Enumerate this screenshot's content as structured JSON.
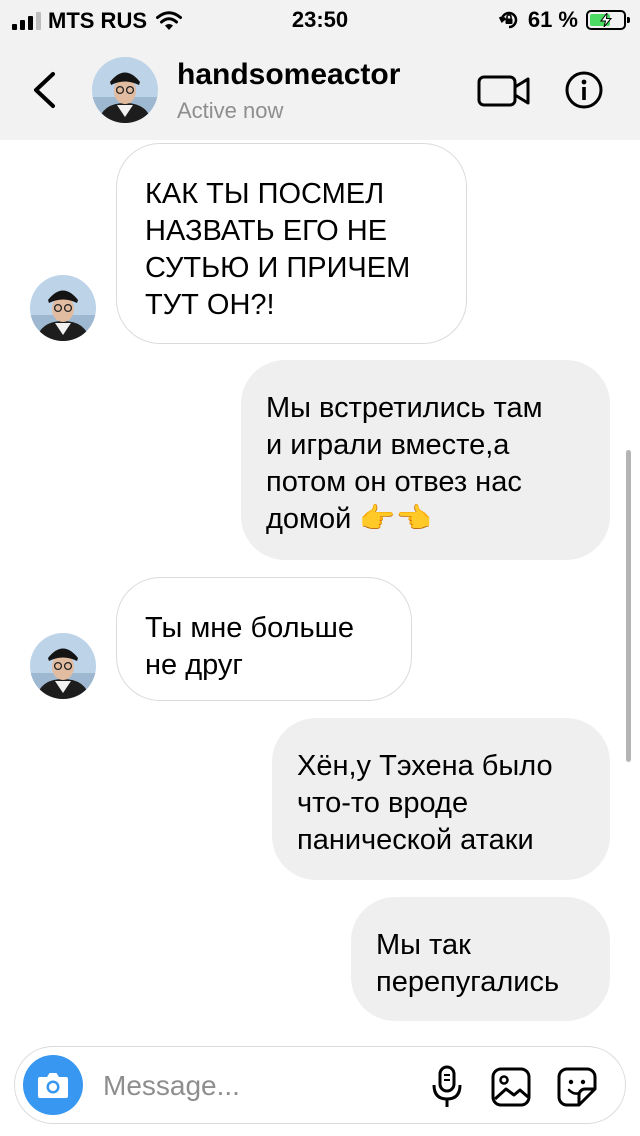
{
  "status_bar": {
    "carrier": "MTS RUS",
    "time": "23:50",
    "battery": "61 %",
    "battery_level": 0.61,
    "icons": [
      "signal-bars-icon",
      "wifi-icon",
      "orientation-lock-icon",
      "battery-charging-icon"
    ]
  },
  "header": {
    "username": "handsomeactor",
    "status": "Active now",
    "icons": [
      "back-chevron-icon",
      "video-call-icon",
      "info-icon"
    ]
  },
  "messages": [
    {
      "direction": "in",
      "lines": [
        "КАК ТЫ ПОСМЕЛ",
        "НАЗВАТЬ ЕГО НЕ",
        "СУТЬЮ И ПРИЧЕМ",
        "ТУТ ОН?!"
      ]
    },
    {
      "direction": "out",
      "lines": [
        "Мы встретились там",
        "и играли вместе,а",
        "потом он отвез нас",
        "домой 👉👈"
      ]
    },
    {
      "direction": "in",
      "lines": [
        "Ты мне больше",
        "не друг"
      ]
    },
    {
      "direction": "out",
      "lines": [
        "Хён,у Тэхена было",
        "что-то вроде",
        "панической атаки"
      ]
    },
    {
      "direction": "out",
      "lines": [
        "Мы так",
        "перепугались"
      ]
    }
  ],
  "composer": {
    "placeholder": "Message...",
    "value": "",
    "icons": [
      "camera-icon",
      "microphone-icon",
      "gallery-icon",
      "sticker-icon"
    ]
  },
  "colors": {
    "bar_background": "#f2f2f2",
    "outgoing_bubble": "#efefef",
    "incoming_border": "#dbdbdb",
    "camera_button": "#3897f0",
    "battery_fill": "#4cd964",
    "secondary_text": "#8e8e8e"
  }
}
